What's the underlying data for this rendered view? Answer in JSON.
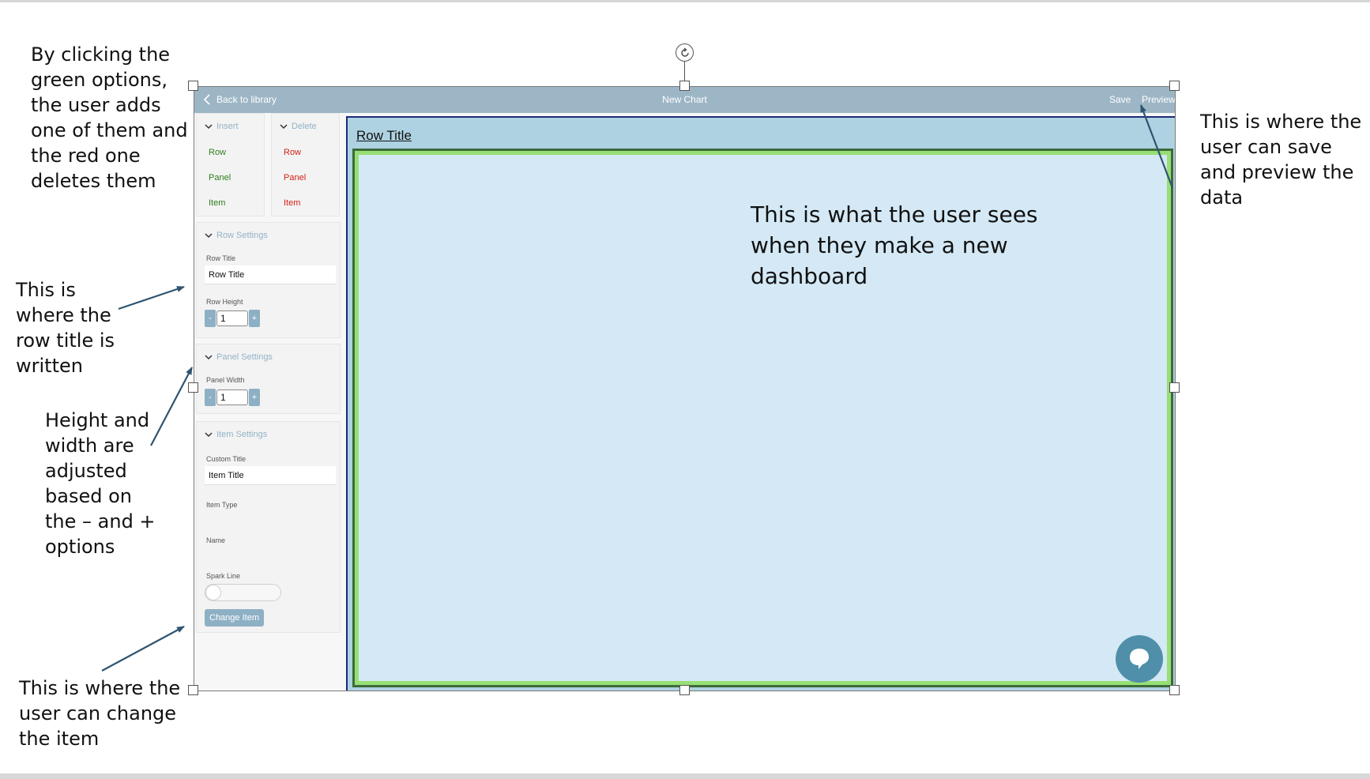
{
  "annotations": {
    "top_left": "By clicking the\ngreen options,\nthe user adds\none of them and\nthe red one\ndeletes them",
    "row_title": "This is\nwhere the\nrow title is\nwritten",
    "height_width": "Height and\nwidth are\nadjusted\nbased on\nthe – and +\noptions",
    "change_item": "This is where the\nuser can change\nthe item",
    "save_preview": "This is where the\nuser can save\nand preview the\ndata",
    "new_dashboard": "This is what the user sees\nwhen they make a new\ndashboard"
  },
  "topbar": {
    "back_label": "Back to library",
    "title": "New Chart",
    "save_label": "Save",
    "preview_label": "Preview"
  },
  "sidebar": {
    "insert": {
      "header": "Insert",
      "items": [
        "Row",
        "Panel",
        "Item"
      ]
    },
    "delete": {
      "header": "Delete",
      "items": [
        "Row",
        "Panel",
        "Item"
      ]
    },
    "row_settings": {
      "header": "Row Settings",
      "title_label": "Row Title",
      "title_value": "Row Title",
      "height_label": "Row Height",
      "height_value": "1"
    },
    "panel_settings": {
      "header": "Panel Settings",
      "width_label": "Panel Width",
      "width_value": "1"
    },
    "item_settings": {
      "header": "Item Settings",
      "custom_title_label": "Custom Title",
      "custom_title_value": "Item Title",
      "item_type_label": "Item Type",
      "name_label": "Name",
      "spark_line_label": "Spark Line",
      "spark_line_on": false,
      "change_button": "Change Item"
    },
    "stepper_minus": "-",
    "stepper_plus": "+"
  },
  "canvas": {
    "row_title": "Row Title"
  },
  "colors": {
    "topbar": "#9db6c6",
    "accent": "#8eb0c4",
    "insert_green": "#2e7d1d",
    "delete_red": "#d22018",
    "row_background": "#aed2e1",
    "panel_background": "#d4e9f5",
    "panel_border": "#97df74",
    "chat_button": "#4f8fa9"
  }
}
